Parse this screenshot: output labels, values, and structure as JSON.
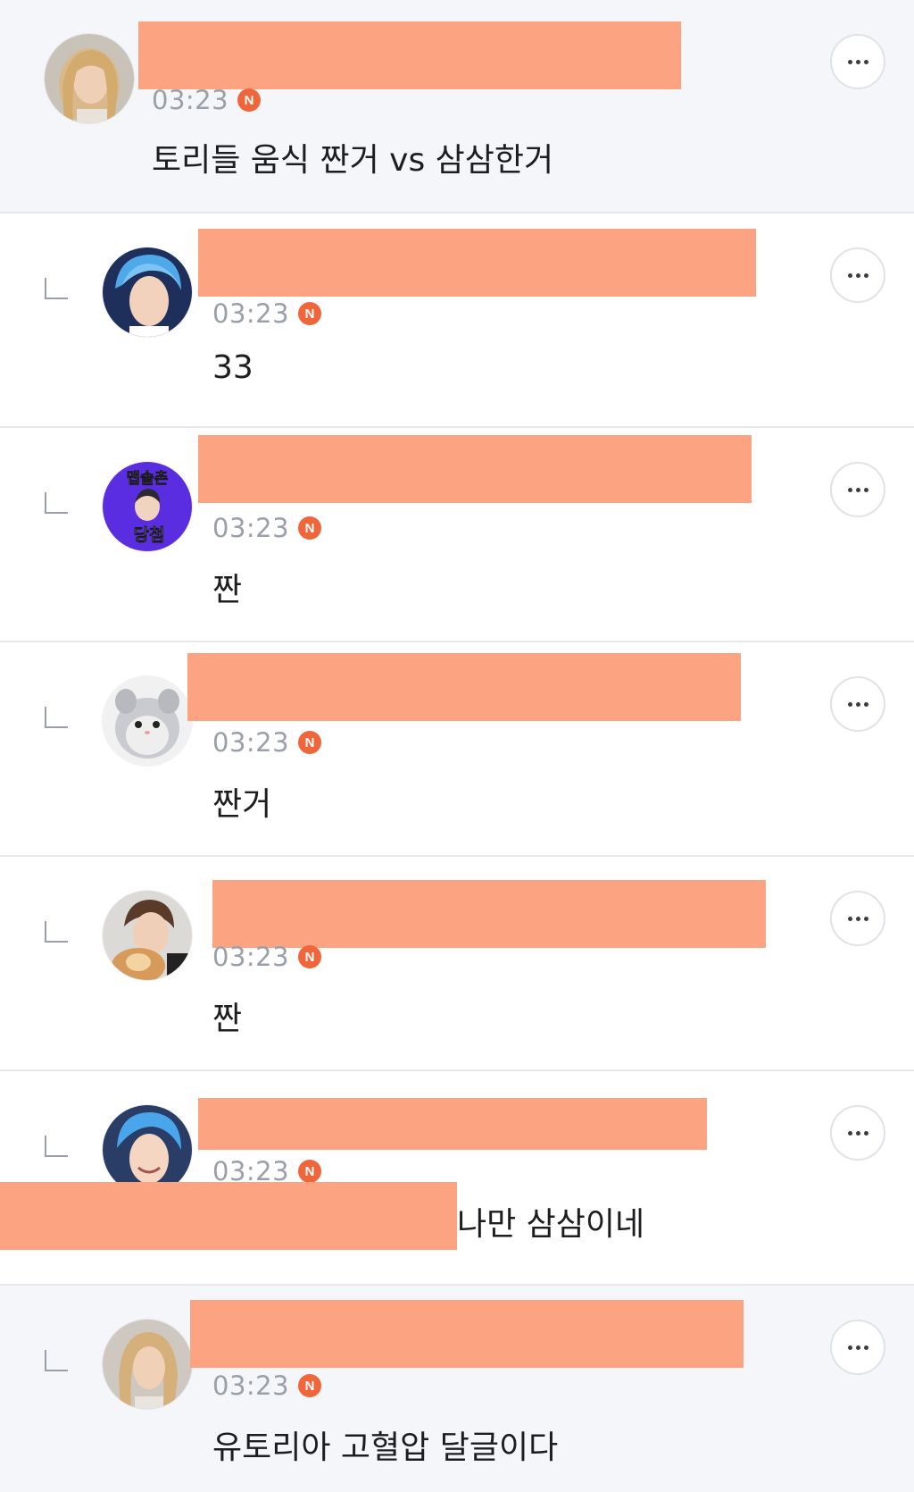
{
  "colors": {
    "redaction": "#fca482",
    "new_badge": "#f0663a",
    "highlight_background": "#f4f6fa",
    "time_text": "#9aa0a8",
    "body_text": "#1d1d1f"
  },
  "icons": {
    "more": "more-horizontal-icon",
    "reply": "reply-indent-icon",
    "new": "new-badge-icon"
  },
  "comments": [
    {
      "time": "03:23",
      "badge": "N",
      "text": "토리들 움식 짠거 vs 삼삼한거",
      "is_reply": false,
      "highlighted": true,
      "author_redacted": true
    },
    {
      "time": "03:23",
      "badge": "N",
      "text": "33",
      "is_reply": true,
      "highlighted": false,
      "author_redacted": true
    },
    {
      "time": "03:23",
      "badge": "N",
      "text": "짠",
      "is_reply": true,
      "highlighted": false,
      "author_redacted": true,
      "avatar_text": [
        "맵솔촌",
        "당첨"
      ]
    },
    {
      "time": "03:23",
      "badge": "N",
      "text": "짠거",
      "is_reply": true,
      "highlighted": false,
      "author_redacted": true
    },
    {
      "time": "03:23",
      "badge": "N",
      "text": "짠",
      "is_reply": true,
      "highlighted": false,
      "author_redacted": true
    },
    {
      "time": "03:23",
      "badge": "N",
      "text": "나만 삼삼이네",
      "is_reply": true,
      "highlighted": false,
      "author_redacted": true,
      "text_partially_redacted": true
    },
    {
      "time": "03:23",
      "badge": "N",
      "text": "유토리아 고혈압 달글이다",
      "is_reply": true,
      "highlighted": true,
      "author_redacted": true
    }
  ]
}
